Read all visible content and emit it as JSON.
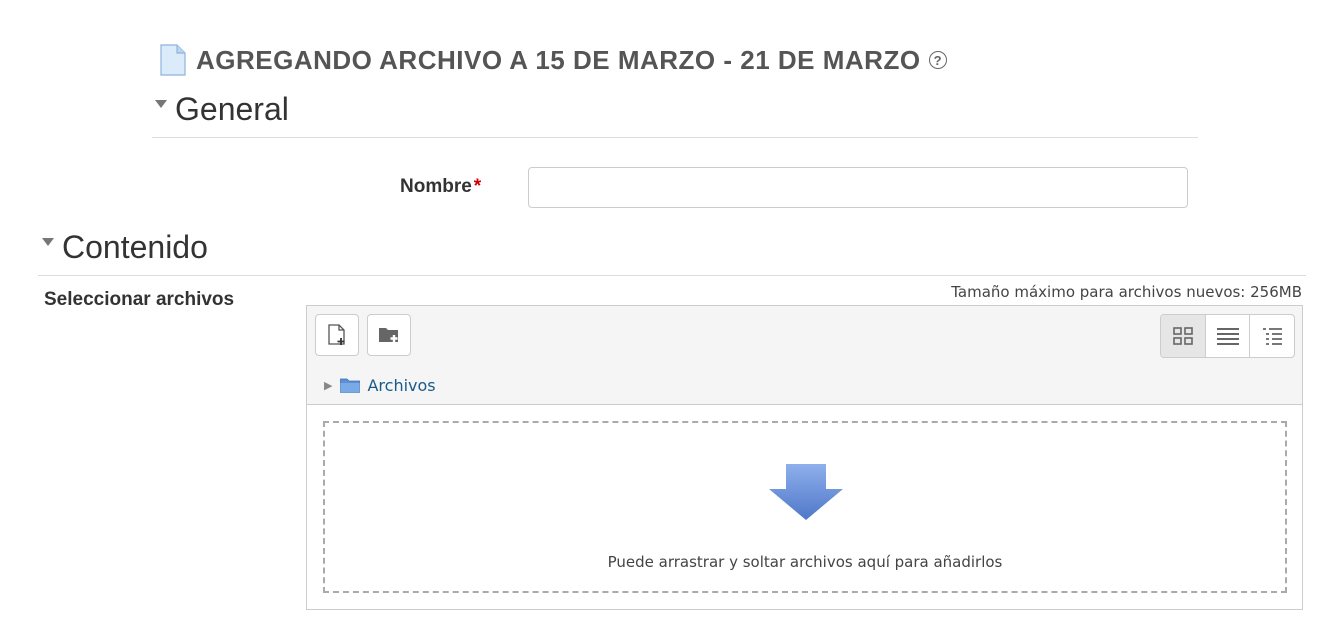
{
  "page": {
    "title": "AGREGANDO ARCHIVO A 15 DE MARZO - 21 DE MARZO",
    "help_icon": "?"
  },
  "sections": {
    "general": {
      "title": "General"
    },
    "contenido": {
      "title": "Contenido"
    }
  },
  "form": {
    "nombre": {
      "label": "Nombre",
      "required_marker": "*",
      "value": ""
    }
  },
  "filemanager": {
    "label": "Seleccionar archivos",
    "max_size_text": "Tamaño máximo para archivos nuevos: 256MB",
    "path": {
      "label": "Archivos"
    },
    "dropzone_text": "Puede arrastrar y soltar archivos aquí para añadirlos",
    "buttons": {
      "add_file": "add-file-icon",
      "create_folder": "create-folder-icon"
    },
    "views": [
      "icons-view",
      "list-view",
      "tree-view"
    ],
    "selected_view": "icons-view"
  },
  "colors": {
    "heading": "#555555",
    "required": "#cc0000",
    "link": "#1a5a8a",
    "arrow": "#5b86d6"
  }
}
